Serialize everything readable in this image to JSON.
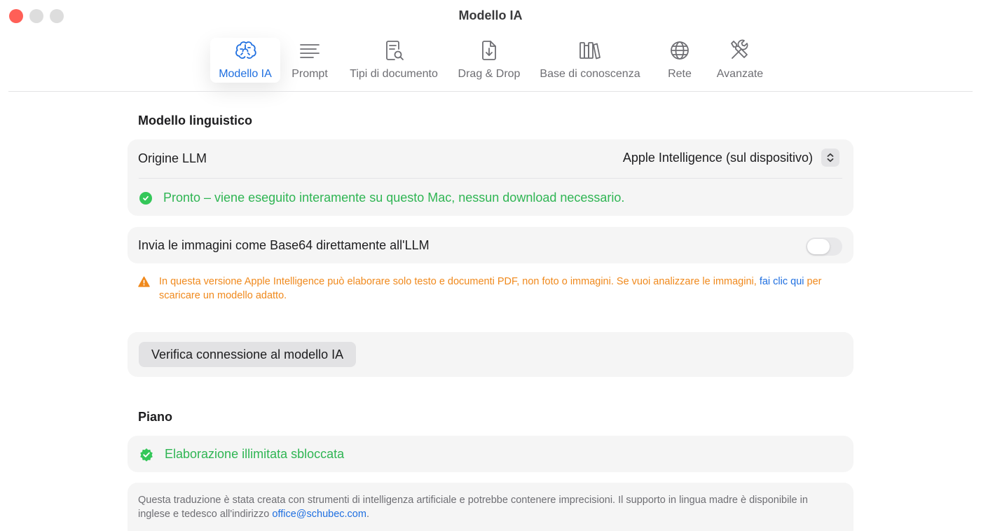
{
  "window": {
    "title": "Modello IA"
  },
  "toolbar": {
    "items": [
      {
        "label": "Modello IA",
        "icon": "brain-icon",
        "active": true
      },
      {
        "label": "Prompt",
        "icon": "text-lines-icon",
        "active": false
      },
      {
        "label": "Tipi di documento",
        "icon": "document-search-icon",
        "active": false
      },
      {
        "label": "Drag & Drop",
        "icon": "document-download-icon",
        "active": false
      },
      {
        "label": "Base di conoscenza",
        "icon": "books-icon",
        "active": false
      },
      {
        "label": "Rete",
        "icon": "globe-icon",
        "active": false
      },
      {
        "label": "Avanzate",
        "icon": "tools-icon",
        "active": false
      }
    ]
  },
  "language_model": {
    "section_title": "Modello linguistico",
    "origin_label": "Origine LLM",
    "origin_value": "Apple Intelligence (sul dispositivo)",
    "status_text": "Pronto – viene eseguito interamente su questo Mac, nessun download necessario.",
    "base64_label": "Invia le immagini come Base64 direttamente all'LLM",
    "base64_enabled": false,
    "warning_text": "In questa versione Apple Intelligence può elaborare solo testo e documenti PDF, non foto o immagini. Se vuoi analizzare le immagini,",
    "warning_link": "fai clic qui",
    "warning_suffix": "per scaricare un modello adatto.",
    "verify_button": "Verifica connessione al modello IA"
  },
  "plan": {
    "section_title": "Piano",
    "status_text": "Elaborazione illimitata sbloccata"
  },
  "footer": {
    "note_text": "Questa traduzione è stata creata con strumenti di intelligenza artificiale e potrebbe contenere imprecisioni. Il supporto in lingua madre è disponibile in inglese e tedesco all'indirizzo",
    "email": "office@schubec.com",
    "note_end": "."
  },
  "colors": {
    "accent": "#1f6fe0",
    "success": "#34c759",
    "warning": "#f0891c",
    "close_button": "#ff5f57"
  }
}
